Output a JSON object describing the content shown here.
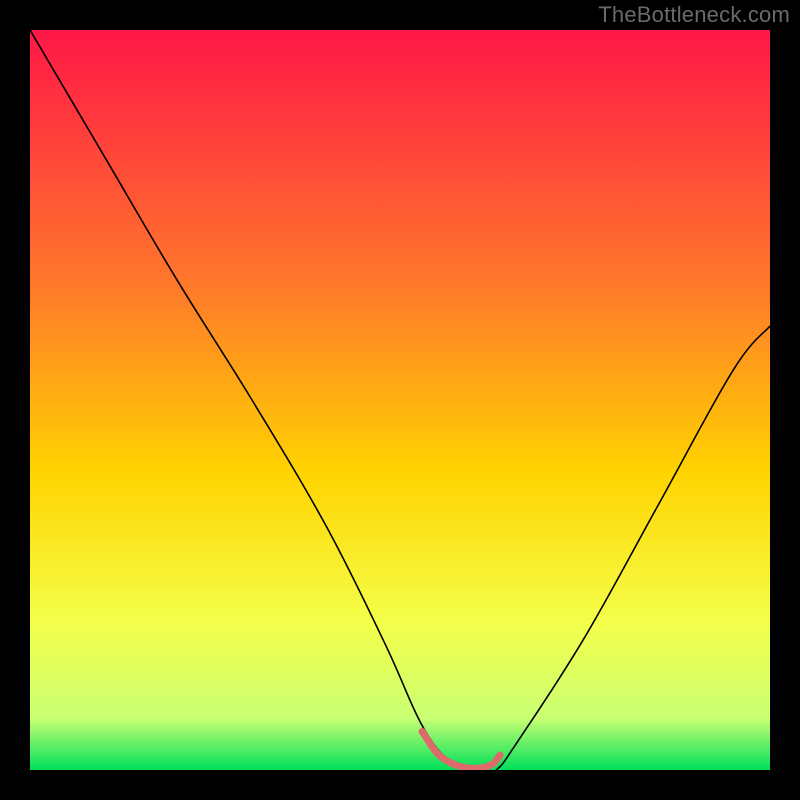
{
  "attribution": "TheBottleneck.com",
  "chart_data": {
    "type": "line",
    "title": "",
    "xlabel": "",
    "ylabel": "",
    "xlim": [
      0,
      100
    ],
    "ylim": [
      0,
      100
    ],
    "grid": false,
    "legend": false,
    "background_gradient": {
      "stops": [
        {
          "offset": 0,
          "color": "#ff1747"
        },
        {
          "offset": 35,
          "color": "#ff7a2a"
        },
        {
          "offset": 60,
          "color": "#ffd400"
        },
        {
          "offset": 80,
          "color": "#f4ff4a"
        },
        {
          "offset": 93,
          "color": "#c9ff73"
        },
        {
          "offset": 100,
          "color": "#00e05a"
        }
      ]
    },
    "series": [
      {
        "name": "curve-black",
        "color": "#000000",
        "stroke_width": 1.6,
        "x": [
          0,
          10,
          20,
          30,
          40,
          48,
          53,
          57,
          61,
          63,
          66,
          75,
          85,
          95,
          100
        ],
        "values": [
          100,
          83,
          66,
          50,
          33,
          17,
          6,
          1,
          0,
          0,
          4,
          18,
          36,
          54,
          60
        ]
      },
      {
        "name": "highlight-pink",
        "color": "#dd6b6b",
        "stroke_width": 7,
        "endpoints": "rounded",
        "x": [
          53,
          55,
          57,
          59,
          61,
          62.5,
          63.5
        ],
        "values": [
          5.2,
          2.3,
          0.9,
          0.3,
          0.3,
          0.8,
          2.0
        ]
      }
    ]
  }
}
